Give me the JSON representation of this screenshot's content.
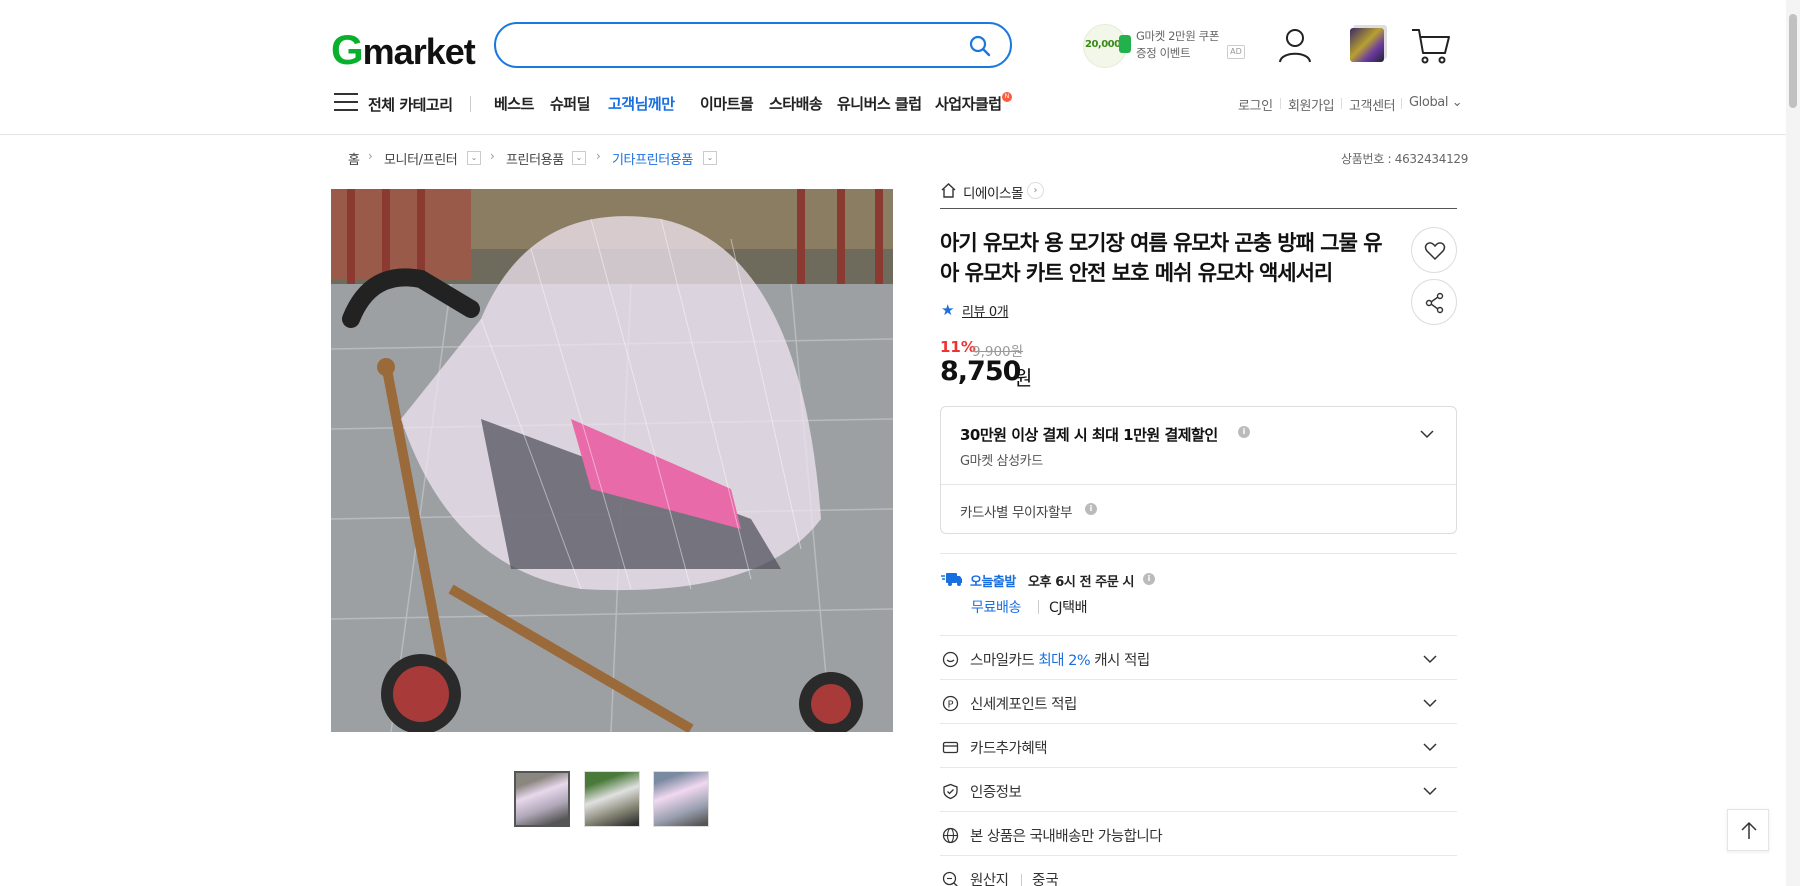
{
  "header": {
    "logo": {
      "g": "G",
      "rest": "market"
    },
    "search": {
      "value": "",
      "placeholder": ""
    },
    "coupon": {
      "amount": "20,000",
      "line1": "G마켓 2만원 쿠폰",
      "line2": "증정 이벤트",
      "ad": "AD"
    }
  },
  "nav": {
    "category": "전체 카테고리",
    "items": [
      {
        "label": "베스트"
      },
      {
        "label": "슈퍼딜"
      },
      {
        "label": "고객님께만"
      },
      {
        "label": "이마트몰"
      },
      {
        "label": "스타배송"
      },
      {
        "label": "유니버스 클럽"
      },
      {
        "label": "사업자클럽"
      }
    ],
    "new_badge": "N",
    "util": [
      "로그인",
      "회원가입",
      "고객센터",
      "Global ⌄"
    ]
  },
  "breadcrumb": {
    "items": [
      "홈",
      "모니터/프린터",
      "프린터용품",
      "기타프린터용품"
    ],
    "product_no": "상품번호 : 4632434129"
  },
  "product": {
    "shop": "디에이스몰",
    "title": "아기 유모차 용 모기장 여름 유모차 곤충 방패 그물 유아 유모차 카트 안전 보호 메쉬 유모차 액세서리",
    "review": "리뷰 0개",
    "discount": "11%",
    "original_price": "9,900원",
    "price": "8,750",
    "price_unit": "원"
  },
  "card_benefit": {
    "title": "30만원 이상 결제 시 최대 1만원 결제할인",
    "sub": "G마켓 삼성카드",
    "installment": "카드사별 무이자할부"
  },
  "delivery": {
    "today": "오늘출발",
    "time": "오후 6시 전 주문 시",
    "free": "무료배송",
    "carrier": "CJ택배"
  },
  "rows": [
    {
      "icon": "smile-card-icon",
      "pre": "스마일카드 ",
      "blue": "최대 2%",
      "post": " 캐시 적립"
    },
    {
      "icon": "point-icon",
      "label": "신세계포인트 적립"
    },
    {
      "icon": "card-icon",
      "label": "카드추가혜택"
    },
    {
      "icon": "shield-icon",
      "label": "인증정보"
    },
    {
      "icon": "globe-icon",
      "label": "본 상품은 국내배송만 가능합니다"
    },
    {
      "icon": "search-origin-icon",
      "label": "원산지",
      "value": "중국"
    }
  ],
  "colors": {
    "brand_green": "#09b02c",
    "accent_blue": "#1a6fe0",
    "discount_red": "#e33333"
  }
}
